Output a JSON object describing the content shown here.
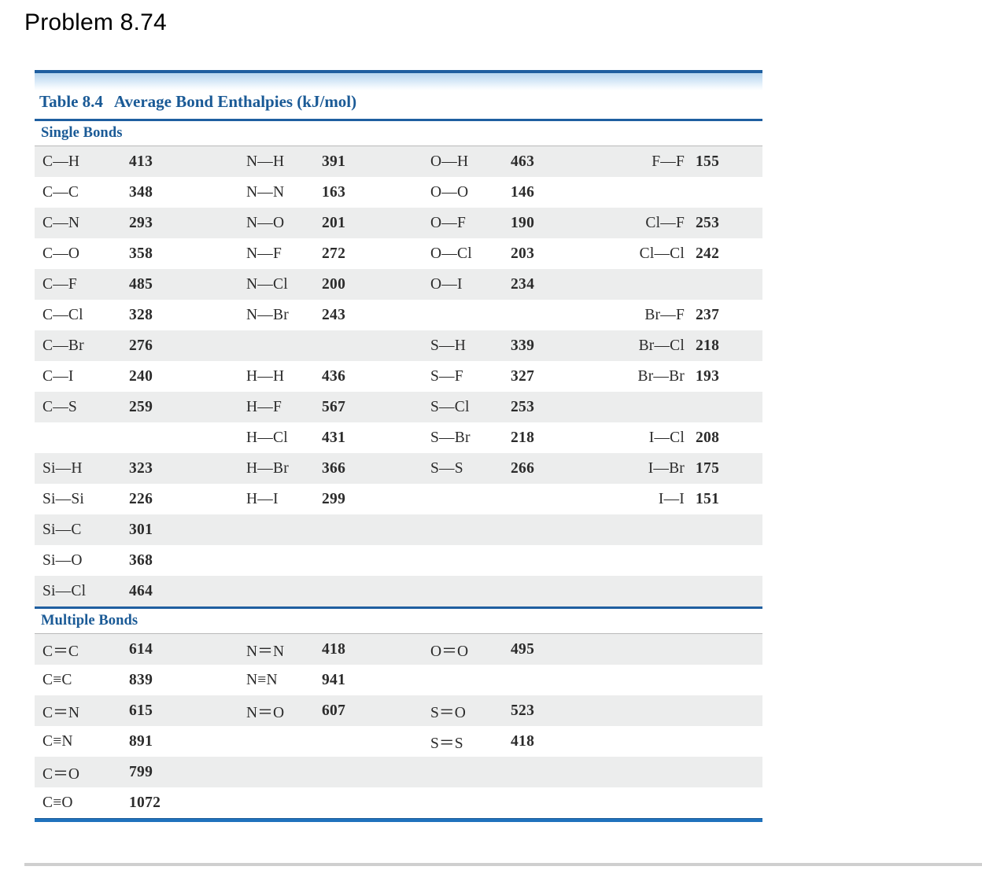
{
  "page": {
    "problem_heading": "Problem 8.74",
    "bottom_divider": "page-divider"
  },
  "table": {
    "caption_number": "Table 8.4",
    "caption_title": "Average Bond Enthalpies (kJ/mol)",
    "units": "kJ/mol",
    "sections": [
      {
        "id": "single",
        "heading": "Single Bonds"
      },
      {
        "id": "multiple",
        "heading": "Multiple Bonds"
      }
    ],
    "colors": {
      "header_blue": "#1a5a96",
      "rule_blue": "#1f5fa0",
      "row_shade": "#eceded",
      "row_plain": "#ffffff",
      "text": "#2b2b2b",
      "grey_rule": "#b9b9b9",
      "page_divider": "#cfcfcf"
    }
  },
  "single_bonds": {
    "rows": [
      {
        "shaded": true,
        "c1b": "C—H",
        "c1v": "413",
        "c2b": "N—H",
        "c2v": "391",
        "c3b": "O—H",
        "c3v": "463",
        "c4b": "F—F",
        "c4v": "155"
      },
      {
        "shaded": false,
        "c1b": "C—C",
        "c1v": "348",
        "c2b": "N—N",
        "c2v": "163",
        "c3b": "O—O",
        "c3v": "146",
        "c4b": "",
        "c4v": ""
      },
      {
        "shaded": true,
        "c1b": "C—N",
        "c1v": "293",
        "c2b": "N—O",
        "c2v": "201",
        "c3b": "O—F",
        "c3v": "190",
        "c4b": "Cl—F",
        "c4v": "253"
      },
      {
        "shaded": false,
        "c1b": "C—O",
        "c1v": "358",
        "c2b": "N—F",
        "c2v": "272",
        "c3b": "O—Cl",
        "c3v": "203",
        "c4b": "Cl—Cl",
        "c4v": "242"
      },
      {
        "shaded": true,
        "c1b": "C—F",
        "c1v": "485",
        "c2b": "N—Cl",
        "c2v": "200",
        "c3b": "O—I",
        "c3v": "234",
        "c4b": "",
        "c4v": ""
      },
      {
        "shaded": false,
        "c1b": "C—Cl",
        "c1v": "328",
        "c2b": "N—Br",
        "c2v": "243",
        "c3b": "",
        "c3v": "",
        "c4b": "Br—F",
        "c4v": "237"
      },
      {
        "shaded": true,
        "c1b": "C—Br",
        "c1v": "276",
        "c2b": "",
        "c2v": "",
        "c3b": "S—H",
        "c3v": "339",
        "c4b": "Br—Cl",
        "c4v": "218"
      },
      {
        "shaded": false,
        "c1b": "C—I",
        "c1v": "240",
        "c2b": "H—H",
        "c2v": "436",
        "c3b": "S—F",
        "c3v": "327",
        "c4b": "Br—Br",
        "c4v": "193"
      },
      {
        "shaded": true,
        "c1b": "C—S",
        "c1v": "259",
        "c2b": "H—F",
        "c2v": "567",
        "c3b": "S—Cl",
        "c3v": "253",
        "c4b": "",
        "c4v": ""
      },
      {
        "shaded": false,
        "c1b": "",
        "c1v": "",
        "c2b": "H—Cl",
        "c2v": "431",
        "c3b": "S—Br",
        "c3v": "218",
        "c4b": "I—Cl",
        "c4v": "208"
      },
      {
        "shaded": true,
        "c1b": "Si—H",
        "c1v": "323",
        "c2b": "H—Br",
        "c2v": "366",
        "c3b": "S—S",
        "c3v": "266",
        "c4b": "I—Br",
        "c4v": "175"
      },
      {
        "shaded": false,
        "c1b": "Si—Si",
        "c1v": "226",
        "c2b": "H—I",
        "c2v": "299",
        "c3b": "",
        "c3v": "",
        "c4b": "I—I",
        "c4v": "151"
      },
      {
        "shaded": true,
        "c1b": "Si—C",
        "c1v": "301",
        "c2b": "",
        "c2v": "",
        "c3b": "",
        "c3v": "",
        "c4b": "",
        "c4v": ""
      },
      {
        "shaded": false,
        "c1b": "Si—O",
        "c1v": "368",
        "c2b": "",
        "c2v": "",
        "c3b": "",
        "c3v": "",
        "c4b": "",
        "c4v": ""
      },
      {
        "shaded": true,
        "c1b": "Si—Cl",
        "c1v": "464",
        "c2b": "",
        "c2v": "",
        "c3b": "",
        "c3v": "",
        "c4b": "",
        "c4v": ""
      }
    ]
  },
  "multiple_bonds": {
    "rows": [
      {
        "shaded": true,
        "c1b": "C＝C",
        "c1v": "614",
        "c2b": "N＝N",
        "c2v": "418",
        "c3b": "O＝O",
        "c3v": "495",
        "c4b": "",
        "c4v": ""
      },
      {
        "shaded": false,
        "c1b": "C≡C",
        "c1v": "839",
        "c2b": "N≡N",
        "c2v": "941",
        "c3b": "",
        "c3v": "",
        "c4b": "",
        "c4v": ""
      },
      {
        "shaded": true,
        "c1b": "C＝N",
        "c1v": "615",
        "c2b": "N＝O",
        "c2v": "607",
        "c3b": "S＝O",
        "c3v": "523",
        "c4b": "",
        "c4v": ""
      },
      {
        "shaded": false,
        "c1b": "C≡N",
        "c1v": "891",
        "c2b": "",
        "c2v": "",
        "c3b": "S＝S",
        "c3v": "418",
        "c4b": "",
        "c4v": ""
      },
      {
        "shaded": true,
        "c1b": "C＝O",
        "c1v": "799",
        "c2b": "",
        "c2v": "",
        "c3b": "",
        "c3v": "",
        "c4b": "",
        "c4v": ""
      },
      {
        "shaded": false,
        "c1b": "C≡O",
        "c1v": "1072",
        "c2b": "",
        "c2v": "",
        "c3b": "",
        "c3v": "",
        "c4b": "",
        "c4v": ""
      }
    ]
  }
}
